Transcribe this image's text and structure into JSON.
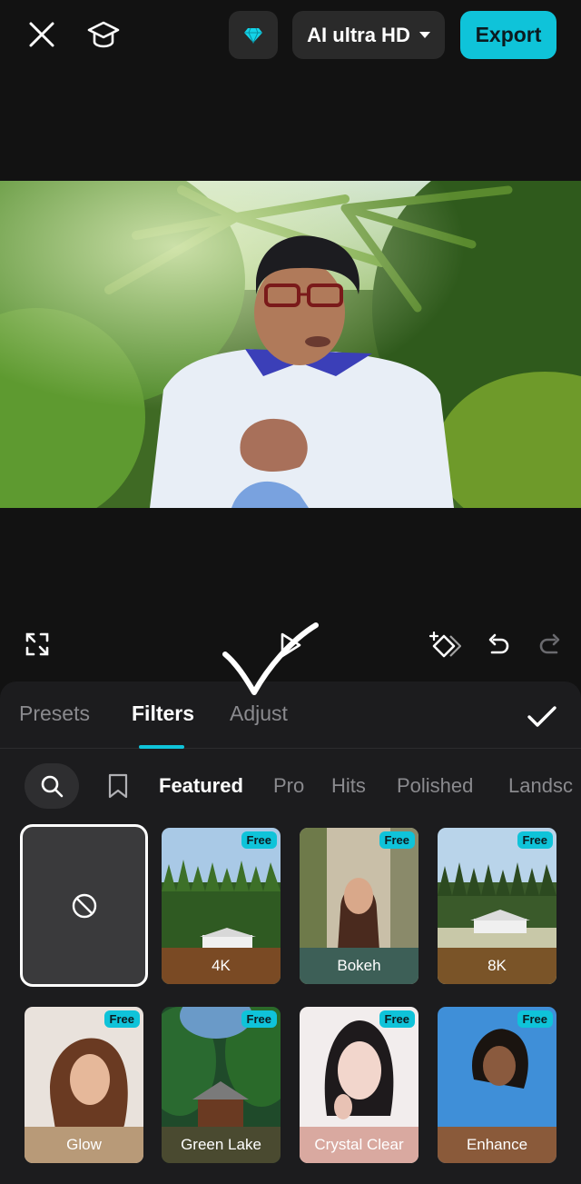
{
  "topbar": {
    "quality_label": "AI ultra HD",
    "export_label": "Export"
  },
  "colors": {
    "accent": "#0fc3d9",
    "background": "#121212",
    "panel": "#1c1c1e"
  },
  "panel": {
    "tabs": [
      {
        "label": "Presets"
      },
      {
        "label": "Filters"
      },
      {
        "label": "Adjust"
      }
    ],
    "active_tab": "Filters",
    "categories": [
      {
        "label": "Featured"
      },
      {
        "label": "Pro"
      },
      {
        "label": "Hits"
      },
      {
        "label": "Polished"
      },
      {
        "label": "Landsc"
      }
    ],
    "active_category": "Featured",
    "filters": [
      {
        "label": "4K",
        "badge": "Free",
        "color": "#7a4a24"
      },
      {
        "label": "Bokeh",
        "badge": "Free",
        "color": "#3d5f57"
      },
      {
        "label": "8K",
        "badge": "Free",
        "color": "#7a5428"
      },
      {
        "label": "Glow",
        "badge": "Free",
        "color": "#b89a78"
      },
      {
        "label": "Green Lake",
        "badge": "Free",
        "color": "#4a4a30"
      },
      {
        "label": "Crystal Clear",
        "badge": "Free",
        "color": "#d9a9a0"
      },
      {
        "label": "Enhance",
        "badge": "Free",
        "color": "#8a5a3a"
      }
    ]
  },
  "icons": [
    "close-icon",
    "graduation-cap-icon",
    "diamond-icon",
    "caret-down-icon",
    "fullscreen-icon",
    "play-icon",
    "keyframe-icon",
    "undo-icon",
    "redo-icon",
    "check-icon",
    "search-icon",
    "bookmark-icon",
    "no-filter-icon"
  ]
}
